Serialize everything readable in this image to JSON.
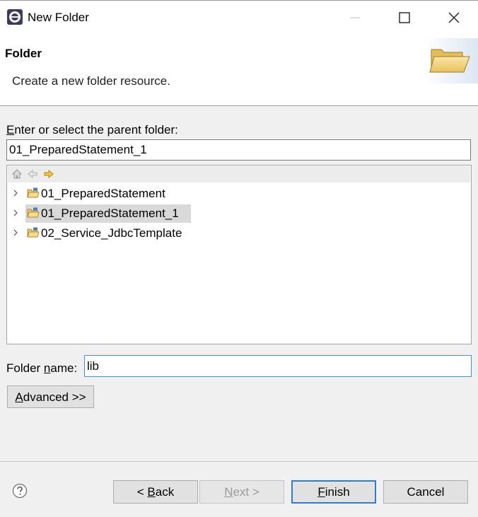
{
  "window": {
    "title": "New Folder"
  },
  "banner": {
    "title": "Folder",
    "description": "Create a new folder resource."
  },
  "parent": {
    "label_mnemonic": "E",
    "label_rest": "nter or select the parent folder:",
    "value": "01_PreparedStatement_1"
  },
  "tree": {
    "items": [
      {
        "label": "01_PreparedStatement",
        "selected": false
      },
      {
        "label": "01_PreparedStatement_1",
        "selected": true
      },
      {
        "label": "02_Service_JdbcTemplate",
        "selected": false
      }
    ]
  },
  "folder_name": {
    "label_before": "Folder ",
    "label_mnemonic": "n",
    "label_after": "ame:",
    "value": "lib"
  },
  "advanced": {
    "mnemonic": "A",
    "rest": "dvanced >>"
  },
  "buttons": {
    "back_prefix": "< ",
    "back_mnemonic": "B",
    "back_rest": "ack",
    "next_mnemonic": "N",
    "next_rest": "ext >",
    "finish_mnemonic": "F",
    "finish_rest": "inish",
    "cancel": "Cancel"
  },
  "colors": {
    "accent": "#2f7fd0",
    "selection": "#d9d9d9",
    "dialog_bg": "#f0f0f0"
  }
}
